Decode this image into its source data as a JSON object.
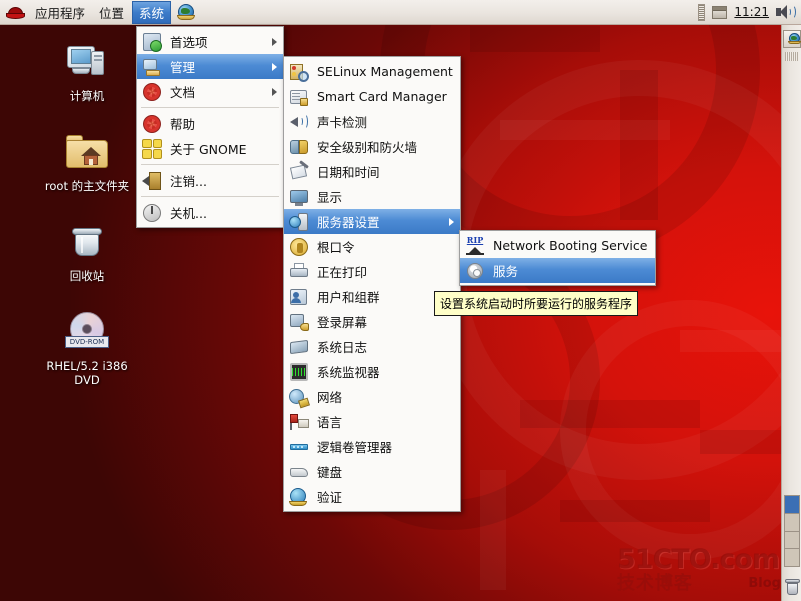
{
  "panel": {
    "applications": "应用程序",
    "places": "位置",
    "system": "系统",
    "browser_icon": "globe-icon",
    "clock": "11:21",
    "volume_icon": "speaker-icon",
    "window_list_icon": "window-icon"
  },
  "desktop": {
    "icons": [
      {
        "label": "计算机",
        "icon": "computer-icon"
      },
      {
        "label": "root 的主文件夹",
        "icon": "home-folder-icon"
      },
      {
        "label": "回收站",
        "icon": "trash-icon"
      },
      {
        "label": "RHEL/5.2 i386 DVD",
        "icon": "dvd-icon",
        "badge": "DVD-ROM"
      }
    ]
  },
  "system_menu": {
    "items": [
      {
        "label": "首选项",
        "icon": "preferences-icon",
        "submenu": true,
        "selected": false
      },
      {
        "label": "管理",
        "icon": "administration-icon",
        "submenu": true,
        "selected": true
      },
      {
        "label": "文档",
        "icon": "documents-icon",
        "submenu": true,
        "selected": false
      },
      {
        "separator": true
      },
      {
        "label": "帮助",
        "icon": "help-icon",
        "submenu": false,
        "selected": false
      },
      {
        "label": "关于 GNOME",
        "icon": "about-gnome-icon",
        "submenu": false,
        "selected": false
      },
      {
        "separator": true
      },
      {
        "label": "注销...",
        "icon": "logout-icon",
        "submenu": false,
        "selected": false
      },
      {
        "separator": true
      },
      {
        "label": "关机...",
        "icon": "shutdown-icon",
        "submenu": false,
        "selected": false
      }
    ]
  },
  "admin_menu": {
    "items": [
      {
        "label": "SELinux Management",
        "icon": "selinux-icon",
        "submenu": false,
        "selected": false
      },
      {
        "label": "Smart Card Manager",
        "icon": "smartcard-icon",
        "submenu": false,
        "selected": false
      },
      {
        "label": "声卡检测",
        "icon": "soundcard-icon",
        "submenu": false,
        "selected": false
      },
      {
        "label": "安全级别和防火墙",
        "icon": "firewall-icon",
        "submenu": false,
        "selected": false
      },
      {
        "label": "日期和时间",
        "icon": "datetime-icon",
        "submenu": false,
        "selected": false
      },
      {
        "label": "显示",
        "icon": "display-icon",
        "submenu": false,
        "selected": false
      },
      {
        "label": "服务器设置",
        "icon": "server-settings-icon",
        "submenu": true,
        "selected": true
      },
      {
        "label": "根口令",
        "icon": "root-password-icon",
        "submenu": false,
        "selected": false
      },
      {
        "label": "正在打印",
        "icon": "printing-icon",
        "submenu": false,
        "selected": false
      },
      {
        "label": "用户和组群",
        "icon": "users-groups-icon",
        "submenu": false,
        "selected": false
      },
      {
        "label": "登录屏幕",
        "icon": "login-screen-icon",
        "submenu": false,
        "selected": false
      },
      {
        "label": "系统日志",
        "icon": "system-log-icon",
        "submenu": false,
        "selected": false
      },
      {
        "label": "系统监视器",
        "icon": "system-monitor-icon",
        "submenu": false,
        "selected": false
      },
      {
        "label": "网络",
        "icon": "network-icon",
        "submenu": false,
        "selected": false
      },
      {
        "label": "语言",
        "icon": "language-icon",
        "submenu": false,
        "selected": false
      },
      {
        "label": "逻辑卷管理器",
        "icon": "lvm-icon",
        "submenu": false,
        "selected": false
      },
      {
        "label": "键盘",
        "icon": "keyboard-icon",
        "submenu": false,
        "selected": false
      },
      {
        "label": "验证",
        "icon": "authentication-icon",
        "submenu": false,
        "selected": false
      }
    ]
  },
  "server_menu": {
    "items": [
      {
        "label": "Network Booting Service",
        "icon": "rip-network-boot-icon",
        "selected": false
      },
      {
        "label": "服务",
        "icon": "services-gear-icon",
        "selected": true
      }
    ]
  },
  "tooltip": {
    "text": "设置系统启动时所要运行的服务程序"
  },
  "watermark": {
    "line1": "51CTO.com",
    "line2": "技术博客",
    "line3": "Blog"
  },
  "colors": {
    "panel_bg": "#eae5df",
    "menu_bg": "#fbfaf8",
    "highlight": "#3d7cc9",
    "tooltip_bg": "#ffffc8",
    "wallpaper_red": "#c2120b"
  }
}
